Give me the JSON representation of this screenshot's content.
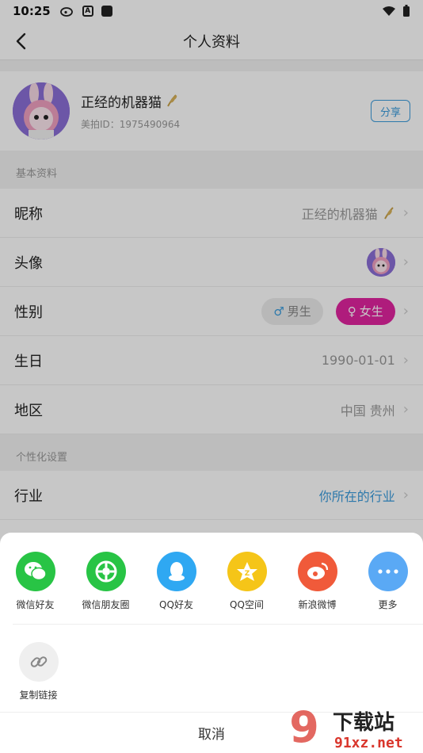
{
  "status": {
    "time": "10:25",
    "icons": [
      "weibo-icon",
      "a-icon",
      "square-icon"
    ],
    "right_icons": [
      "wifi-icon",
      "battery-icon"
    ]
  },
  "header": {
    "title": "个人资料"
  },
  "profile": {
    "name": "正经的机器猫",
    "id_text": "美拍ID：1975490964",
    "share_label": "分享"
  },
  "sections": {
    "basic": "基本资料",
    "personal": "个性化设置"
  },
  "rows": {
    "nickname": {
      "label": "昵称",
      "value": "正经的机器猫"
    },
    "avatar": {
      "label": "头像"
    },
    "gender": {
      "label": "性别",
      "male": "男生",
      "female": "女生",
      "selected": "female"
    },
    "birthday": {
      "label": "生日",
      "value": "1990-01-01"
    },
    "region": {
      "label": "地区",
      "value": "中国 贵州"
    },
    "industry": {
      "label": "行业",
      "value": "你所在的行业"
    }
  },
  "share_sheet": {
    "items": [
      {
        "label": "微信好友",
        "icon": "wechat-icon",
        "color": "#28c445"
      },
      {
        "label": "微信朋友圈",
        "icon": "wechat-moments-icon",
        "color": "#28c445"
      },
      {
        "label": "QQ好友",
        "icon": "qq-icon",
        "color": "#2fa8f2"
      },
      {
        "label": "QQ空间",
        "icon": "qzone-icon",
        "color": "#f5c518"
      },
      {
        "label": "新浪微博",
        "icon": "weibo-icon",
        "color": "#f05a3a"
      },
      {
        "label": "更多",
        "icon": "more-icon",
        "color": "#5aa9f5"
      }
    ],
    "copy_link": "复制链接",
    "cancel": "取消"
  },
  "watermark": {
    "text": "下载站",
    "domain": "91xz.net",
    "badge": "9"
  },
  "colors": {
    "accent": "#3a9bdc",
    "female": "#e0249f"
  }
}
